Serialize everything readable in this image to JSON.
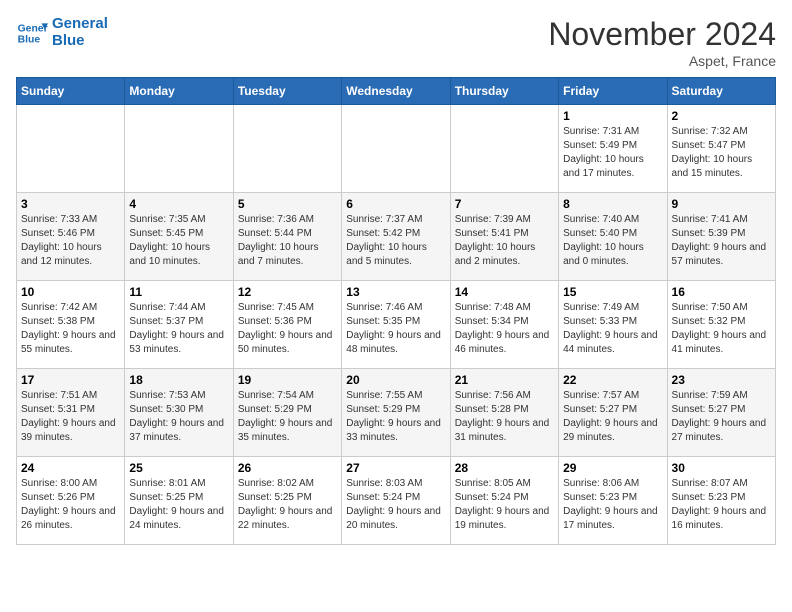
{
  "header": {
    "logo_line1": "General",
    "logo_line2": "Blue",
    "month": "November 2024",
    "location": "Aspet, France"
  },
  "weekdays": [
    "Sunday",
    "Monday",
    "Tuesday",
    "Wednesday",
    "Thursday",
    "Friday",
    "Saturday"
  ],
  "weeks": [
    [
      {
        "day": "",
        "info": ""
      },
      {
        "day": "",
        "info": ""
      },
      {
        "day": "",
        "info": ""
      },
      {
        "day": "",
        "info": ""
      },
      {
        "day": "",
        "info": ""
      },
      {
        "day": "1",
        "info": "Sunrise: 7:31 AM\nSunset: 5:49 PM\nDaylight: 10 hours and 17 minutes."
      },
      {
        "day": "2",
        "info": "Sunrise: 7:32 AM\nSunset: 5:47 PM\nDaylight: 10 hours and 15 minutes."
      }
    ],
    [
      {
        "day": "3",
        "info": "Sunrise: 7:33 AM\nSunset: 5:46 PM\nDaylight: 10 hours and 12 minutes."
      },
      {
        "day": "4",
        "info": "Sunrise: 7:35 AM\nSunset: 5:45 PM\nDaylight: 10 hours and 10 minutes."
      },
      {
        "day": "5",
        "info": "Sunrise: 7:36 AM\nSunset: 5:44 PM\nDaylight: 10 hours and 7 minutes."
      },
      {
        "day": "6",
        "info": "Sunrise: 7:37 AM\nSunset: 5:42 PM\nDaylight: 10 hours and 5 minutes."
      },
      {
        "day": "7",
        "info": "Sunrise: 7:39 AM\nSunset: 5:41 PM\nDaylight: 10 hours and 2 minutes."
      },
      {
        "day": "8",
        "info": "Sunrise: 7:40 AM\nSunset: 5:40 PM\nDaylight: 10 hours and 0 minutes."
      },
      {
        "day": "9",
        "info": "Sunrise: 7:41 AM\nSunset: 5:39 PM\nDaylight: 9 hours and 57 minutes."
      }
    ],
    [
      {
        "day": "10",
        "info": "Sunrise: 7:42 AM\nSunset: 5:38 PM\nDaylight: 9 hours and 55 minutes."
      },
      {
        "day": "11",
        "info": "Sunrise: 7:44 AM\nSunset: 5:37 PM\nDaylight: 9 hours and 53 minutes."
      },
      {
        "day": "12",
        "info": "Sunrise: 7:45 AM\nSunset: 5:36 PM\nDaylight: 9 hours and 50 minutes."
      },
      {
        "day": "13",
        "info": "Sunrise: 7:46 AM\nSunset: 5:35 PM\nDaylight: 9 hours and 48 minutes."
      },
      {
        "day": "14",
        "info": "Sunrise: 7:48 AM\nSunset: 5:34 PM\nDaylight: 9 hours and 46 minutes."
      },
      {
        "day": "15",
        "info": "Sunrise: 7:49 AM\nSunset: 5:33 PM\nDaylight: 9 hours and 44 minutes."
      },
      {
        "day": "16",
        "info": "Sunrise: 7:50 AM\nSunset: 5:32 PM\nDaylight: 9 hours and 41 minutes."
      }
    ],
    [
      {
        "day": "17",
        "info": "Sunrise: 7:51 AM\nSunset: 5:31 PM\nDaylight: 9 hours and 39 minutes."
      },
      {
        "day": "18",
        "info": "Sunrise: 7:53 AM\nSunset: 5:30 PM\nDaylight: 9 hours and 37 minutes."
      },
      {
        "day": "19",
        "info": "Sunrise: 7:54 AM\nSunset: 5:29 PM\nDaylight: 9 hours and 35 minutes."
      },
      {
        "day": "20",
        "info": "Sunrise: 7:55 AM\nSunset: 5:29 PM\nDaylight: 9 hours and 33 minutes."
      },
      {
        "day": "21",
        "info": "Sunrise: 7:56 AM\nSunset: 5:28 PM\nDaylight: 9 hours and 31 minutes."
      },
      {
        "day": "22",
        "info": "Sunrise: 7:57 AM\nSunset: 5:27 PM\nDaylight: 9 hours and 29 minutes."
      },
      {
        "day": "23",
        "info": "Sunrise: 7:59 AM\nSunset: 5:27 PM\nDaylight: 9 hours and 27 minutes."
      }
    ],
    [
      {
        "day": "24",
        "info": "Sunrise: 8:00 AM\nSunset: 5:26 PM\nDaylight: 9 hours and 26 minutes."
      },
      {
        "day": "25",
        "info": "Sunrise: 8:01 AM\nSunset: 5:25 PM\nDaylight: 9 hours and 24 minutes."
      },
      {
        "day": "26",
        "info": "Sunrise: 8:02 AM\nSunset: 5:25 PM\nDaylight: 9 hours and 22 minutes."
      },
      {
        "day": "27",
        "info": "Sunrise: 8:03 AM\nSunset: 5:24 PM\nDaylight: 9 hours and 20 minutes."
      },
      {
        "day": "28",
        "info": "Sunrise: 8:05 AM\nSunset: 5:24 PM\nDaylight: 9 hours and 19 minutes."
      },
      {
        "day": "29",
        "info": "Sunrise: 8:06 AM\nSunset: 5:23 PM\nDaylight: 9 hours and 17 minutes."
      },
      {
        "day": "30",
        "info": "Sunrise: 8:07 AM\nSunset: 5:23 PM\nDaylight: 9 hours and 16 minutes."
      }
    ]
  ]
}
